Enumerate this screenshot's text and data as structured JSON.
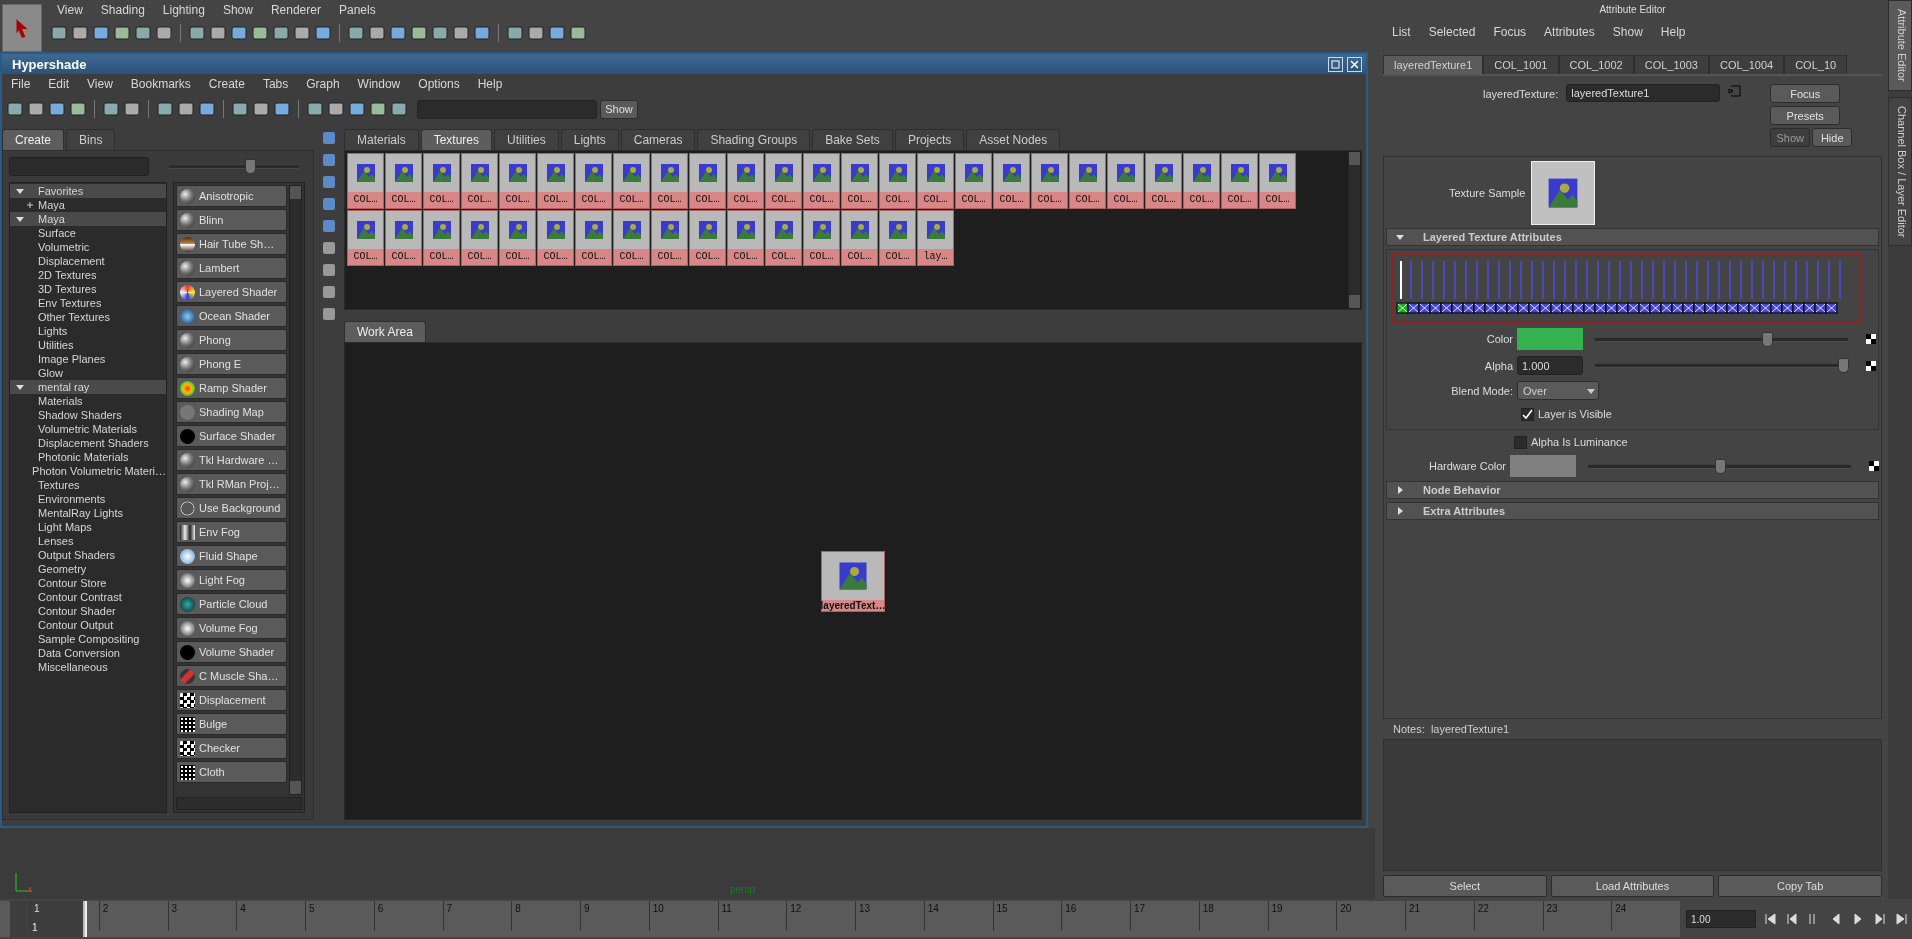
{
  "viewport": {
    "menus": [
      "View",
      "Shading",
      "Lighting",
      "Show",
      "Renderer",
      "Panels"
    ],
    "camera_label": "persp"
  },
  "hypershade": {
    "title": "Hypershade",
    "menus": [
      "File",
      "Edit",
      "View",
      "Bookmarks",
      "Create",
      "Tabs",
      "Graph",
      "Window",
      "Options",
      "Help"
    ],
    "show_button": "Show",
    "create_tabs": [
      {
        "label": "Create",
        "selected": true
      },
      {
        "label": "Bins",
        "selected": false
      }
    ],
    "size_slider": {
      "level": 0.62
    },
    "tree": [
      {
        "label": "Favorites",
        "expanded": true,
        "children": [
          {
            "label": "Maya",
            "expanded": false
          }
        ]
      },
      {
        "label": "Maya",
        "expanded": true,
        "children": [
          {
            "label": "Surface"
          },
          {
            "label": "Volumetric"
          },
          {
            "label": "Displacement"
          },
          {
            "label": "2D Textures"
          },
          {
            "label": "3D Textures"
          },
          {
            "label": "Env Textures"
          },
          {
            "label": "Other Textures"
          },
          {
            "label": "Lights"
          },
          {
            "label": "Utilities"
          },
          {
            "label": "Image Planes"
          },
          {
            "label": "Glow"
          }
        ]
      },
      {
        "label": "mental ray",
        "expanded": true,
        "children": [
          {
            "label": "Materials"
          },
          {
            "label": "Shadow Shaders"
          },
          {
            "label": "Volumetric Materials"
          },
          {
            "label": "Displacement Shaders"
          },
          {
            "label": "Photonic Materials"
          },
          {
            "label": "Photon Volumetric Materi…"
          },
          {
            "label": "Textures"
          },
          {
            "label": "Environments"
          },
          {
            "label": "MentalRay Lights"
          },
          {
            "label": "Light Maps"
          },
          {
            "label": "Lenses"
          },
          {
            "label": "Output Shaders"
          },
          {
            "label": "Geometry"
          },
          {
            "label": "Contour Store"
          },
          {
            "label": "Contour Contrast"
          },
          {
            "label": "Contour Shader"
          },
          {
            "label": "Contour Output"
          },
          {
            "label": "Sample Compositing"
          },
          {
            "label": "Data Conversion"
          },
          {
            "label": "Miscellaneous"
          }
        ]
      }
    ],
    "nodes": [
      {
        "label": "Anisotropic",
        "kind": "sphere"
      },
      {
        "label": "Blinn",
        "kind": "sphere"
      },
      {
        "label": "Hair Tube Sh…",
        "kind": "stripe"
      },
      {
        "label": "Lambert",
        "kind": "sphere"
      },
      {
        "label": "Layered Shader",
        "kind": "multi"
      },
      {
        "label": "Ocean Shader",
        "kind": "ocean"
      },
      {
        "label": "Phong",
        "kind": "sphere"
      },
      {
        "label": "Phong E",
        "kind": "sphere"
      },
      {
        "label": "Ramp Shader",
        "kind": "ramp"
      },
      {
        "label": "Shading Map",
        "kind": "flat"
      },
      {
        "label": "Surface Shader",
        "kind": "black"
      },
      {
        "label": "Tkl Hardware …",
        "kind": "sphere"
      },
      {
        "label": "Tkl RMan Proj…",
        "kind": "sphere"
      },
      {
        "label": "Use Background",
        "kind": "ring"
      },
      {
        "label": "Env Fog",
        "kind": "fog"
      },
      {
        "label": "Fluid Shape",
        "kind": "fluid"
      },
      {
        "label": "Light Fog",
        "kind": "glow"
      },
      {
        "label": "Particle Cloud",
        "kind": "cloud"
      },
      {
        "label": "Volume Fog",
        "kind": "glow"
      },
      {
        "label": "Volume Shader",
        "kind": "black"
      },
      {
        "label": "C Muscle Sha…",
        "kind": "muscle"
      },
      {
        "label": "Displacement",
        "kind": "checker"
      },
      {
        "label": "Bulge",
        "kind": "dots"
      },
      {
        "label": "Checker",
        "kind": "checker"
      },
      {
        "label": "Cloth",
        "kind": "dots"
      }
    ],
    "tabs": [
      {
        "label": "Materials",
        "selected": false
      },
      {
        "label": "Textures",
        "selected": true
      },
      {
        "label": "Utilities",
        "selected": false
      },
      {
        "label": "Lights",
        "selected": false
      },
      {
        "label": "Cameras",
        "selected": false
      },
      {
        "label": "Shading Groups",
        "selected": false
      },
      {
        "label": "Bake Sets",
        "selected": false
      },
      {
        "label": "Projects",
        "selected": false
      },
      {
        "label": "Asset Nodes",
        "selected": false
      }
    ],
    "textures": [
      "COL…",
      "COL…",
      "COL…",
      "COL…",
      "COL…",
      "COL…",
      "COL…",
      "COL…",
      "COL…",
      "COL…",
      "COL…",
      "COL…",
      "COL…",
      "COL…",
      "COL…",
      "COL…",
      "COL…",
      "COL…",
      "COL…",
      "COL…",
      "COL…",
      "COL…",
      "COL…",
      "COL…",
      "COL…",
      "COL…",
      "COL…",
      "COL…",
      "COL…",
      "COL…",
      "COL…",
      "COL…",
      "COL…",
      "COL…",
      "COL…",
      "COL…",
      "COL…",
      "COL…",
      "COL…",
      "COL…",
      "lay…"
    ],
    "work_area": {
      "tab": "Work Area",
      "node": "layeredText…"
    }
  },
  "attribute_editor": {
    "title": "Attribute Editor",
    "menus": [
      "List",
      "Selected",
      "Focus",
      "Attributes",
      "Show",
      "Help"
    ],
    "tabs": [
      {
        "label": "layeredTexture1",
        "selected": true
      },
      {
        "label": "COL_1001",
        "selected": false
      },
      {
        "label": "COL_1002",
        "selected": false
      },
      {
        "label": "COL_1003",
        "selected": false
      },
      {
        "label": "COL_1004",
        "selected": false
      },
      {
        "label": "COL_10",
        "selected": false
      }
    ],
    "node_label": "layeredTexture:",
    "node_name": "layeredTexture1",
    "buttons": [
      {
        "label": "Focus",
        "disabled": false
      },
      {
        "label": "Presets",
        "disabled": false
      },
      {
        "label": "Show",
        "disabled": true
      },
      {
        "label": "Hide",
        "disabled": false
      }
    ],
    "sample_label": "Texture Sample",
    "section": {
      "title": "Layered Texture Attributes",
      "expanded": true
    },
    "color": {
      "label": "Color",
      "color": "#33b24f",
      "level": 0.68
    },
    "alpha": {
      "label": "Alpha",
      "value": "1.000",
      "level": 0.98
    },
    "blend": {
      "label": "Blend Mode:",
      "value": "Over"
    },
    "layer_visible": {
      "label": "Layer is Visible",
      "checked": true
    },
    "alpha_luminance": {
      "label": "Alpha Is Luminance",
      "checked": false
    },
    "hardware_color": {
      "label": "Hardware Color",
      "color": "#808080",
      "level": 0.5
    },
    "sections": [
      {
        "title": "Node Behavior",
        "expanded": false
      },
      {
        "title": "Extra Attributes",
        "expanded": false
      }
    ],
    "notes_label": "Notes:  layeredTexture1",
    "bottom_buttons": [
      "Select",
      "Load Attributes",
      "Copy Tab"
    ],
    "side_tabs": [
      {
        "label": "Attribute Editor",
        "selected": true
      },
      {
        "label": "Channel Box / Layer Editor",
        "selected": false
      }
    ]
  },
  "timeline": {
    "frames": [
      "1",
      "2",
      "3",
      "4",
      "5",
      "6",
      "7",
      "8",
      "9",
      "10",
      "11",
      "12",
      "13",
      "14",
      "15",
      "16",
      "17",
      "18",
      "19",
      "20",
      "21",
      "22",
      "23",
      "24"
    ],
    "current_frame": "1",
    "playhead": {
      "level": 0
    },
    "current_time": "1.00"
  }
}
